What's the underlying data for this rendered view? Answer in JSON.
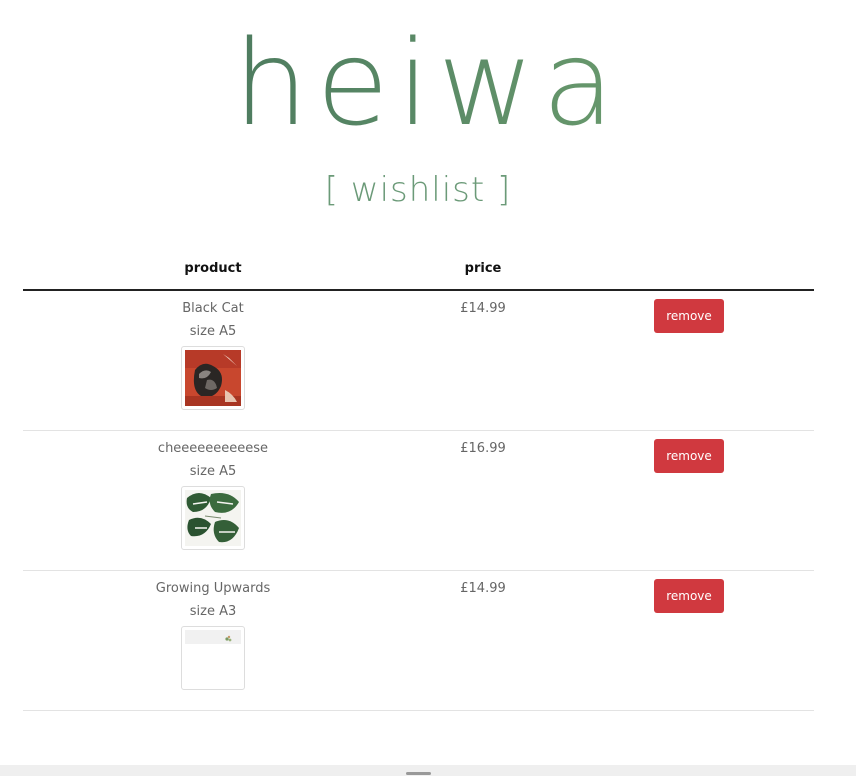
{
  "brand": {
    "logo_text": "heiwa"
  },
  "page": {
    "title": "[ wishlist ]"
  },
  "table": {
    "headers": {
      "product": "product",
      "price": "price"
    },
    "rows": [
      {
        "name": "Black Cat",
        "size": "size A5",
        "price": "£14.99",
        "remove_label": "remove",
        "thumbnail_icon": "cat-artwork-image"
      },
      {
        "name": "cheeeeeeeeeese",
        "size": "size A5",
        "price": "£16.99",
        "remove_label": "remove",
        "thumbnail_icon": "monstera-leaf-image"
      },
      {
        "name": "Growing Upwards",
        "size": "size A3",
        "price": "£14.99",
        "remove_label": "remove",
        "thumbnail_icon": "plant-sketch-image"
      }
    ]
  },
  "colors": {
    "accent": "#6b9a78",
    "danger": "#d0393f",
    "logo_start": "#3f6b57",
    "logo_end": "#79aa74"
  }
}
